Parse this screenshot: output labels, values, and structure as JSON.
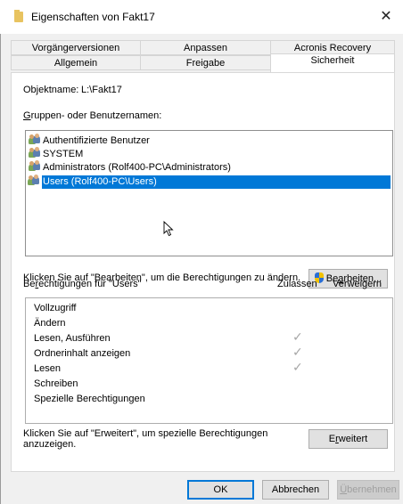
{
  "window": {
    "title": "Eigenschaften von Fakt17",
    "close_glyph": "✕"
  },
  "tabs_row1": [
    "Vorgängerversionen",
    "Anpassen",
    "Acronis Recovery"
  ],
  "tabs_row2": [
    "Allgemein",
    "Freigabe",
    "Sicherheit"
  ],
  "object": {
    "label": "Objektname:",
    "value": "L:\\Fakt17"
  },
  "groups": {
    "label_first": "G",
    "label_rest": "ruppen- oder Benutzernamen:",
    "items": [
      "Authentifizierte Benutzer",
      "SYSTEM",
      "Administrators (Rolf400-PC\\Administrators)",
      "Users (Rolf400-PC\\Users)"
    ],
    "selected_index": 3
  },
  "edit": {
    "hint": "Klicken Sie auf \"Bearbeiten\", um die Berechtigungen zu ändern.",
    "button_pre": "Be",
    "button_ul": "a",
    "button_post": "rbeiten..."
  },
  "permissions": {
    "label_pre": "Be",
    "label_ul": "r",
    "label_post": "echtigungen für \"Users\"",
    "col_allow": "Zulassen",
    "col_deny": "Verweigern",
    "rows": [
      {
        "name": "Vollzugriff",
        "allow": false,
        "deny": false
      },
      {
        "name": "Ändern",
        "allow": false,
        "deny": false
      },
      {
        "name": "Lesen, Ausführen",
        "allow": true,
        "deny": false
      },
      {
        "name": "Ordnerinhalt anzeigen",
        "allow": true,
        "deny": false
      },
      {
        "name": "Lesen",
        "allow": true,
        "deny": false
      },
      {
        "name": "Schreiben",
        "allow": false,
        "deny": false
      },
      {
        "name": "Spezielle Berechtigungen",
        "allow": false,
        "deny": false
      }
    ],
    "check_glyph": "✓"
  },
  "advanced": {
    "hint_line1": "Klicken Sie auf \"Erweitert\", um spezielle Berechtigungen",
    "hint_line2": "anzuzeigen.",
    "button_pre": "E",
    "button_ul": "r",
    "button_post": "weitert"
  },
  "footer": {
    "ok": "OK",
    "cancel": "Abbrechen",
    "apply_ul": "Ü",
    "apply_rest": "bernehmen"
  },
  "colors": {
    "selection": "#0078d7",
    "folder": "#e8c360",
    "check": "#a6a6a6"
  }
}
